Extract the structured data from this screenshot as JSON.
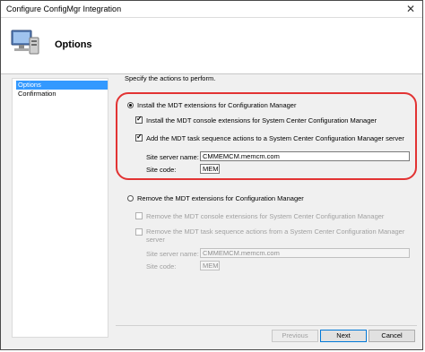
{
  "window": {
    "title": "Configure ConfigMgr Integration",
    "close_glyph": "✕"
  },
  "header": {
    "title": "Options",
    "icon": "computer-icon"
  },
  "nav": {
    "items": [
      {
        "label": "Options"
      },
      {
        "label": "Confirmation"
      }
    ]
  },
  "main": {
    "instruction": "Specify the actions to perform.",
    "install": {
      "label": "Install the MDT extensions for Configuration Manager",
      "selected": true,
      "console_ext_label": "Install the MDT console extensions for System Center Configuration Manager",
      "task_seq_label": "Add the MDT task sequence actions to a System Center Configuration Manager server",
      "site_server_label": "Site server name:",
      "site_server_value": "CMMEMCM.memcm.com",
      "site_code_label": "Site code:",
      "site_code_value": "MEM"
    },
    "remove": {
      "label": "Remove the MDT extensions for Configuration Manager",
      "selected": false,
      "console_ext_label": "Remove the MDT console extensions for System Center Configuration Manager",
      "task_seq_label_line1": "Remove the MDT task sequence actions from a System Center Configuration Manager",
      "task_seq_label_line2": "server",
      "site_server_label": "Site server name:",
      "site_server_value": "CMMEMCM.memcm.com",
      "site_code_label": "Site code:",
      "site_code_value": "MEM"
    }
  },
  "footer": {
    "previous_label": "Previous",
    "next_label": "Next",
    "cancel_label": "Cancel"
  },
  "colors": {
    "highlight": "#e23333",
    "selection": "#3399ff"
  }
}
